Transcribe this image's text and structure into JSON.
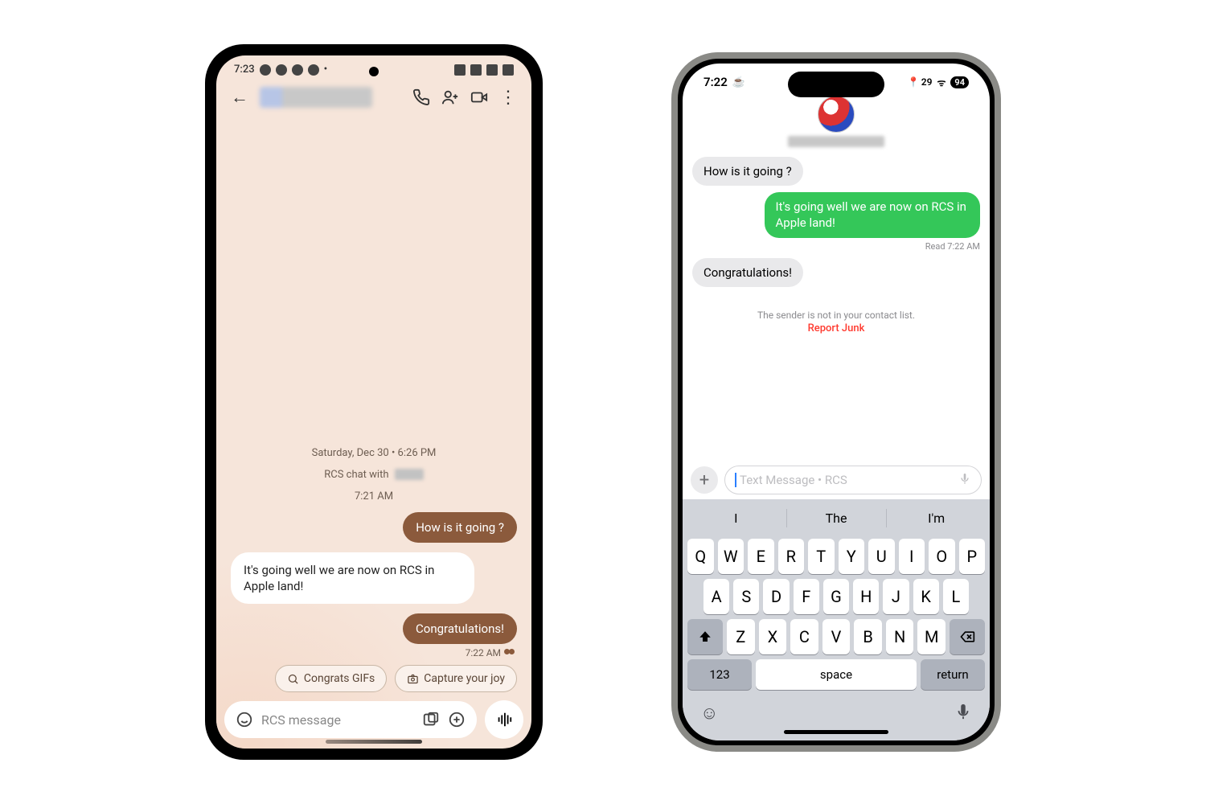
{
  "android": {
    "status": {
      "time": "7:23"
    },
    "conversation": {
      "date_header": "Saturday, Dec 30 • 6:26 PM",
      "rcs_label": "RCS chat with",
      "time_header": "7:21 AM",
      "msg_out_1": "How is it going ?",
      "msg_in_1": "It's going well we are now on RCS in Apple land!",
      "msg_out_2": "Congratulations!",
      "read_time": "7:22 AM"
    },
    "suggestions": {
      "chip1": "Congrats GIFs",
      "chip2": "Capture your joy"
    },
    "compose": {
      "placeholder": "RCS message"
    }
  },
  "iphone": {
    "status": {
      "time": "7:22",
      "location_count": "29",
      "battery": "94"
    },
    "conversation": {
      "msg_in_1": "How is it going ?",
      "msg_out_1": "It's going well we are now on RCS in Apple land!",
      "read": "Read 7:22 AM",
      "msg_in_2": "Congratulations!",
      "warn": "The sender is not in your contact list.",
      "report": "Report Junk"
    },
    "compose": {
      "placeholder": "Text Message • RCS"
    },
    "keyboard": {
      "suggest": [
        "I",
        "The",
        "I'm"
      ],
      "row1": [
        "Q",
        "W",
        "E",
        "R",
        "T",
        "Y",
        "U",
        "I",
        "O",
        "P"
      ],
      "row2": [
        "A",
        "S",
        "D",
        "F",
        "G",
        "H",
        "J",
        "K",
        "L"
      ],
      "row3": [
        "Z",
        "X",
        "C",
        "V",
        "B",
        "N",
        "M"
      ],
      "numbers": "123",
      "space": "space",
      "return": "return"
    }
  }
}
